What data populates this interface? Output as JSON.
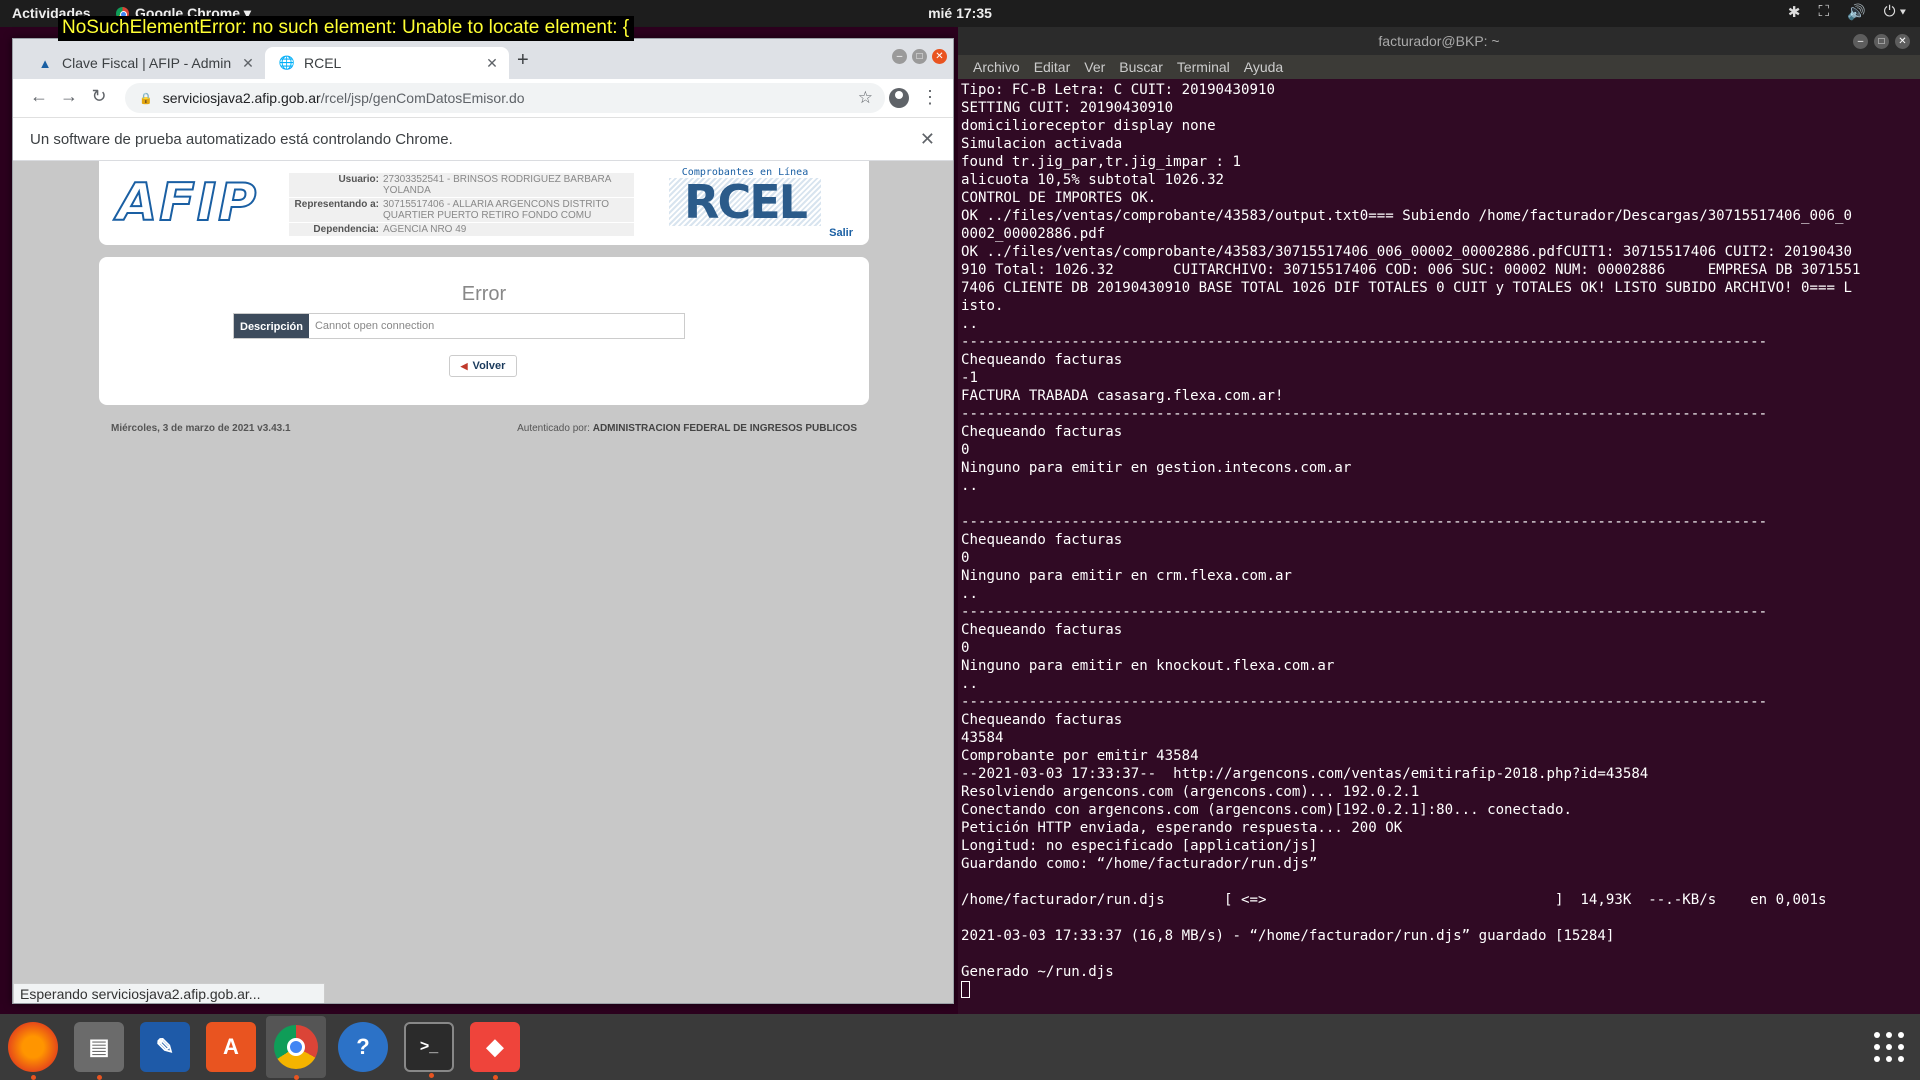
{
  "topbar": {
    "activities": "Actividades",
    "app_menu": "Google Chrome ▾",
    "clock": "mié 17:35"
  },
  "selenium_error": "NoSuchElementError: no such element: Unable to locate element: {",
  "chrome": {
    "tabs": [
      {
        "label": "Clave Fiscal | AFIP - Admin",
        "icon": "afip-favicon"
      },
      {
        "label": "RCEL",
        "icon": "globe-icon"
      }
    ],
    "url_host": "serviciosjava2.afip.gob.ar",
    "url_path": "/rcel/jsp/genComDatosEmisor.do",
    "infobar_text": "Un software de prueba automatizado está controlando Chrome.",
    "status_text": "Esperando serviciosjava2.afip.gob.ar..."
  },
  "afip": {
    "logo": "AFIP",
    "usuario_label": "Usuario:",
    "usuario_value": "27303352541 - BRINSOS RODRIGUEZ BARBARA YOLANDA",
    "representando_label": "Representando a:",
    "representando_value": "30715517406 - ALLARIA ARGENCONS DISTRITO QUARTIER PUERTO RETIRO FONDO COMU",
    "dependencia_label": "Dependencia:",
    "dependencia_value": "AGENCIA NRO 49",
    "rcel_subtitle": "Comprobantes en Línea",
    "rcel_word": "RCEL",
    "salir": "Salir",
    "error_title": "Error",
    "descripcion_label": "Descripción",
    "descripcion_value": "Cannot open connection",
    "volver": "Volver",
    "footer_left": "Miércoles, 3 de marzo de 2021 v3.43.1",
    "footer_right_prefix": "Autenticado por:",
    "footer_right_entity": "ADMINISTRACION FEDERAL DE INGRESOS PUBLICOS"
  },
  "terminal": {
    "title": "facturador@BKP: ~",
    "menu": [
      "Archivo",
      "Editar",
      "Ver",
      "Buscar",
      "Terminal",
      "Ayuda"
    ],
    "output": "Tipo: FC-B Letra: C CUIT: 20190430910\nSETTING CUIT: 20190430910\ndomicilioreceptor display none\nSimulacion activada\nfound tr.jig_par,tr.jig_impar : 1\nalicuota 10,5% subtotal 1026.32\nCONTROL DE IMPORTES OK.\nOK ../files/ventas/comprobante/43583/output.txt0=== Subiendo /home/facturador/Descargas/30715517406_006_0\n0002_00002886.pdf\nOK ../files/ventas/comprobante/43583/30715517406_006_00002_00002886.pdfCUIT1: 30715517406 CUIT2: 20190430\n910 Total: 1026.32       CUITARCHIVO: 30715517406 COD: 006 SUC: 00002 NUM: 00002886     EMPRESA DB 3071551\n7406 CLIENTE DB 20190430910 BASE TOTAL 1026 DIF TOTALES 0 CUIT y TOTALES OK! LISTO SUBIDO ARCHIVO! 0=== L\nisto.\n..\n-----------------------------------------------------------------------------------------------\nChequeando facturas\n-1\nFACTURA TRABADA casasarg.flexa.com.ar!\n-----------------------------------------------------------------------------------------------\nChequeando facturas\n0\nNinguno para emitir en gestion.intecons.com.ar\n..\n\n-----------------------------------------------------------------------------------------------\nChequeando facturas\n0\nNinguno para emitir en crm.flexa.com.ar\n..\n-----------------------------------------------------------------------------------------------\nChequeando facturas\n0\nNinguno para emitir en knockout.flexa.com.ar\n..\n-----------------------------------------------------------------------------------------------\nChequeando facturas\n43584\nComprobante por emitir 43584\n--2021-03-03 17:33:37--  http://argencons.com/ventas/emitirafip-2018.php?id=43584\nResolviendo argencons.com (argencons.com)... 192.0.2.1\nConectando con argencons.com (argencons.com)[192.0.2.1]:80... conectado.\nPetición HTTP enviada, esperando respuesta... 200 OK\nLongitud: no especificado [application/js]\nGuardando como: “/home/facturador/run.djs”\n\n/home/facturador/run.djs       [ <=>                                  ]  14,93K  --.-KB/s    en 0,001s\n\n2021-03-03 17:33:37 (16,8 MB/s) - “/home/facturador/run.djs” guardado [15284]\n\nGenerado ~/run.djs\n"
  },
  "dock": {
    "apps": [
      {
        "name": "firefox",
        "glyph": "🦊"
      },
      {
        "name": "files",
        "glyph": "▤"
      },
      {
        "name": "writer",
        "glyph": "✎"
      },
      {
        "name": "software",
        "glyph": "A"
      },
      {
        "name": "chrome",
        "glyph": ""
      },
      {
        "name": "help",
        "glyph": "?"
      },
      {
        "name": "terminal",
        "glyph": ">_"
      },
      {
        "name": "anydesk",
        "glyph": "◆"
      }
    ]
  },
  "colors": {
    "ubuntu_orange": "#e95420",
    "terminal_bg": "#300a24",
    "afip_blue": "#1a5fa3"
  }
}
